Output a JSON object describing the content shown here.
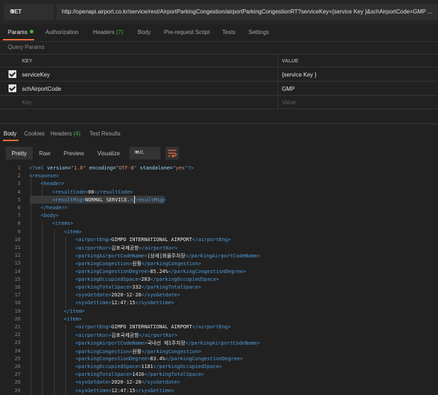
{
  "request": {
    "method": "GET",
    "url": "http://openapi.airport.co.kr/service/rest/AirportParkingCongestion/airportParkingCongestionRT?serviceKey={service Key }&schAirportCode=GMP ..."
  },
  "request_tabs": [
    {
      "label": "Params"
    },
    {
      "label": "Authorization"
    },
    {
      "label": "Headers",
      "count": "(7)"
    },
    {
      "label": "Body"
    },
    {
      "label": "Pre-request Script"
    },
    {
      "label": "Tests"
    },
    {
      "label": "Settings"
    }
  ],
  "query_params": {
    "label": "Query Params",
    "key_header": "KEY",
    "value_header": "VALUE",
    "rows": [
      {
        "key": "serviceKey",
        "value": "{service Key }",
        "checked": true
      },
      {
        "key": "schAirportCode",
        "value": "GMP",
        "checked": true
      }
    ],
    "key_placeholder": "Key",
    "value_placeholder": "Value"
  },
  "response_tabs": [
    {
      "label": "Body"
    },
    {
      "label": "Cookies"
    },
    {
      "label": "Headers",
      "count": "(4)"
    },
    {
      "label": "Test Results"
    }
  ],
  "view_modes": [
    "Pretty",
    "Raw",
    "Preview",
    "Visualize"
  ],
  "language": "XML",
  "icons": {
    "wrap": "wrap-lines-icon",
    "caret": "chevron-down-icon",
    "check": "check-icon"
  },
  "colors": {
    "accent": "#f26b3a",
    "status_green": "#4bb543",
    "tag": "#4f9bd9",
    "attr": "#9cdcfe",
    "string": "#ce9178"
  },
  "code_lines": [
    {
      "n": "1",
      "ind": 0,
      "parts": [
        [
          "tg",
          "<?xml "
        ],
        [
          "at",
          "version="
        ],
        [
          "av",
          "\"1.0\""
        ],
        [
          "tx",
          " "
        ],
        [
          "at",
          "encoding="
        ],
        [
          "av",
          "\"UTF-8\""
        ],
        [
          "tx",
          " "
        ],
        [
          "at",
          "standalone="
        ],
        [
          "av",
          "\"yes\""
        ],
        [
          "tg",
          "?>"
        ]
      ]
    },
    {
      "n": "2",
      "ind": 0,
      "parts": [
        [
          "tg",
          "<response>"
        ]
      ]
    },
    {
      "n": "3",
      "ind": 1,
      "parts": [
        [
          "tg",
          "<header>"
        ]
      ]
    },
    {
      "n": "4",
      "ind": 2,
      "parts": [
        [
          "tg",
          "<resultCode>"
        ],
        [
          "tx",
          "00"
        ],
        [
          "tg",
          "</resultCode>"
        ]
      ]
    },
    {
      "n": "5",
      "ind": 2,
      "parts": [
        [
          "tg",
          "<resultMsg>"
        ],
        [
          "tx",
          "NORMAL SERVICE."
        ],
        [
          "tg",
          "</resultMsg>"
        ]
      ]
    },
    {
      "n": "6",
      "ind": 1,
      "parts": [
        [
          "tg",
          "</header>"
        ]
      ]
    },
    {
      "n": "7",
      "ind": 1,
      "parts": [
        [
          "tg",
          "<body>"
        ]
      ]
    },
    {
      "n": "8",
      "ind": 2,
      "parts": [
        [
          "tg",
          "<items>"
        ]
      ]
    },
    {
      "n": "9",
      "ind": 3,
      "parts": [
        [
          "tg",
          "<item>"
        ]
      ]
    },
    {
      "n": "10",
      "ind": 4,
      "parts": [
        [
          "tg",
          "<airportEng>"
        ],
        [
          "tx",
          "GIMPO INTERNATIONAL AIRPORT"
        ],
        [
          "tg",
          "</airportEng>"
        ]
      ]
    },
    {
      "n": "11",
      "ind": 4,
      "parts": [
        [
          "tg",
          "<airportKor>"
        ],
        [
          "tx",
          "김포국제공항"
        ],
        [
          "tg",
          "</airportKor>"
        ]
      ]
    },
    {
      "n": "12",
      "ind": 4,
      "parts": [
        [
          "tg",
          "<parkingAirportCodeName>"
        ],
        [
          "tx",
          "[상세]화물주차장"
        ],
        [
          "tg",
          "</parkingAirportCodeName>"
        ]
      ]
    },
    {
      "n": "13",
      "ind": 4,
      "parts": [
        [
          "tg",
          "<parkingCongestion>"
        ],
        [
          "tx",
          "원활"
        ],
        [
          "tg",
          "</parkingCongestion>"
        ]
      ]
    },
    {
      "n": "14",
      "ind": 4,
      "parts": [
        [
          "tg",
          "<parkingCongestionDegree>"
        ],
        [
          "tx",
          "85.24%"
        ],
        [
          "tg",
          "</parkingCongestionDegree>"
        ]
      ]
    },
    {
      "n": "15",
      "ind": 4,
      "parts": [
        [
          "tg",
          "<parkingOccupiedSpace>"
        ],
        [
          "tx",
          "283"
        ],
        [
          "tg",
          "</parkingOccupiedSpace>"
        ]
      ]
    },
    {
      "n": "16",
      "ind": 4,
      "parts": [
        [
          "tg",
          "<parkingTotalSpace>"
        ],
        [
          "tx",
          "332"
        ],
        [
          "tg",
          "</parkingTotalSpace>"
        ]
      ]
    },
    {
      "n": "17",
      "ind": 4,
      "parts": [
        [
          "tg",
          "<sysGetdate>"
        ],
        [
          "tx",
          "2020-12-28"
        ],
        [
          "tg",
          "</sysGetdate>"
        ]
      ]
    },
    {
      "n": "18",
      "ind": 4,
      "parts": [
        [
          "tg",
          "<sysGettime>"
        ],
        [
          "tx",
          "12:47:15"
        ],
        [
          "tg",
          "</sysGettime>"
        ]
      ]
    },
    {
      "n": "19",
      "ind": 3,
      "parts": [
        [
          "tg",
          "</item>"
        ]
      ]
    },
    {
      "n": "20",
      "ind": 3,
      "parts": [
        [
          "tg",
          "<item>"
        ]
      ]
    },
    {
      "n": "21",
      "ind": 4,
      "parts": [
        [
          "tg",
          "<airportEng>"
        ],
        [
          "tx",
          "GIMPO INTERNATIONAL AIRPORT"
        ],
        [
          "tg",
          "</airportEng>"
        ]
      ]
    },
    {
      "n": "22",
      "ind": 4,
      "parts": [
        [
          "tg",
          "<airportKor>"
        ],
        [
          "tx",
          "김포국제공항"
        ],
        [
          "tg",
          "</airportKor>"
        ]
      ]
    },
    {
      "n": "23",
      "ind": 4,
      "parts": [
        [
          "tg",
          "<parkingAirportCodeName>"
        ],
        [
          "tx",
          "국내선 제1주차장"
        ],
        [
          "tg",
          "</parkingAirportCodeName>"
        ]
      ]
    },
    {
      "n": "24",
      "ind": 4,
      "parts": [
        [
          "tg",
          "<parkingCongestion>"
        ],
        [
          "tx",
          "원활"
        ],
        [
          "tg",
          "</parkingCongestion>"
        ]
      ]
    },
    {
      "n": "25",
      "ind": 4,
      "parts": [
        [
          "tg",
          "<parkingCongestionDegree>"
        ],
        [
          "tx",
          "83.4%"
        ],
        [
          "tg",
          "</parkingCongestionDegree>"
        ]
      ]
    },
    {
      "n": "26",
      "ind": 4,
      "parts": [
        [
          "tg",
          "<parkingOccupiedSpace>"
        ],
        [
          "tx",
          "1181"
        ],
        [
          "tg",
          "</parkingOccupiedSpace>"
        ]
      ]
    },
    {
      "n": "27",
      "ind": 4,
      "parts": [
        [
          "tg",
          "<parkingTotalSpace>"
        ],
        [
          "tx",
          "1416"
        ],
        [
          "tg",
          "</parkingTotalSpace>"
        ]
      ]
    },
    {
      "n": "28",
      "ind": 4,
      "parts": [
        [
          "tg",
          "<sysGetdate>"
        ],
        [
          "tx",
          "2020-12-28"
        ],
        [
          "tg",
          "</sysGetdate>"
        ]
      ]
    },
    {
      "n": "29",
      "ind": 4,
      "parts": [
        [
          "tg",
          "<sysGettime>"
        ],
        [
          "tx",
          "12:47:15"
        ],
        [
          "tg",
          "</sysGettime>"
        ]
      ]
    }
  ]
}
